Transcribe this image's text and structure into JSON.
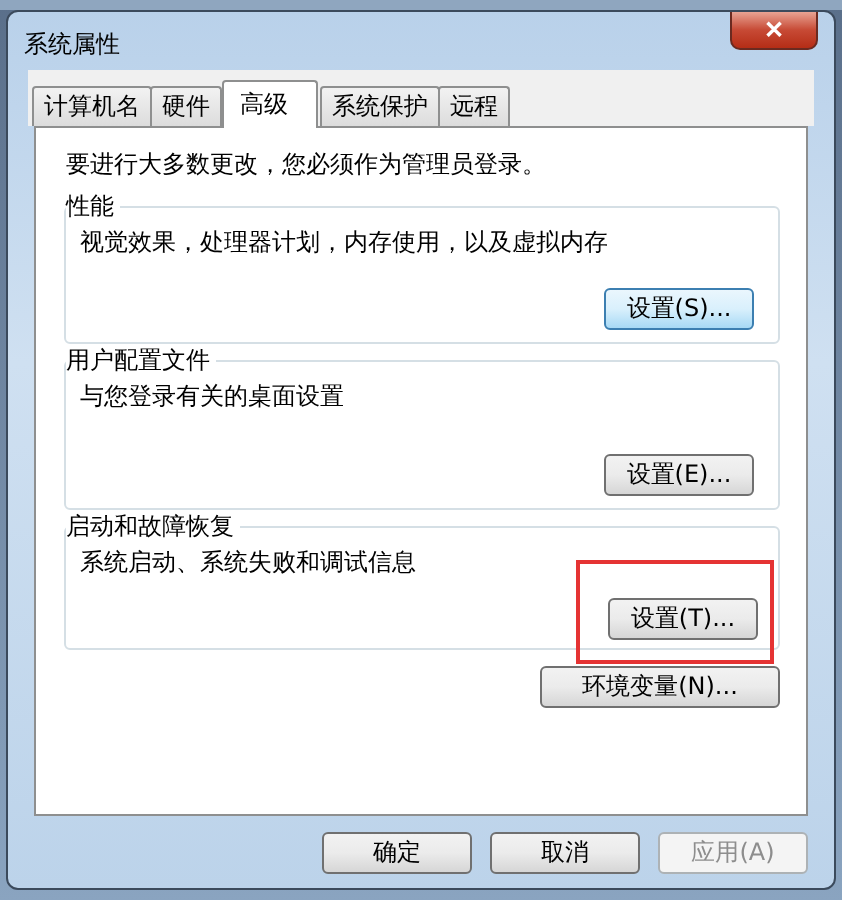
{
  "window": {
    "title": "系统属性",
    "close": "✕"
  },
  "tabs": [
    {
      "label": "计算机名",
      "selected": false
    },
    {
      "label": "硬件",
      "selected": false
    },
    {
      "label": "高级",
      "selected": true
    },
    {
      "label": "系统保护",
      "selected": false
    },
    {
      "label": "远程",
      "selected": false
    }
  ],
  "notice": "要进行大多数更改，您必须作为管理员登录。",
  "groups": [
    {
      "title": "性能",
      "description": "视觉效果，处理器计划，内存使用，以及虚拟内存",
      "button": "设置(S)...",
      "focused": true,
      "highlighted": false
    },
    {
      "title": "用户配置文件",
      "description": "与您登录有关的桌面设置",
      "button": "设置(E)...",
      "focused": false,
      "highlighted": false
    },
    {
      "title": "启动和故障恢复",
      "description": "系统启动、系统失败和调试信息",
      "button": "设置(T)...",
      "focused": false,
      "highlighted": true
    }
  ],
  "env_button": "环境变量(N)...",
  "footer_buttons": [
    {
      "label": "确定",
      "disabled": false
    },
    {
      "label": "取消",
      "disabled": false
    },
    {
      "label": "应用(A)",
      "disabled": true
    }
  ]
}
